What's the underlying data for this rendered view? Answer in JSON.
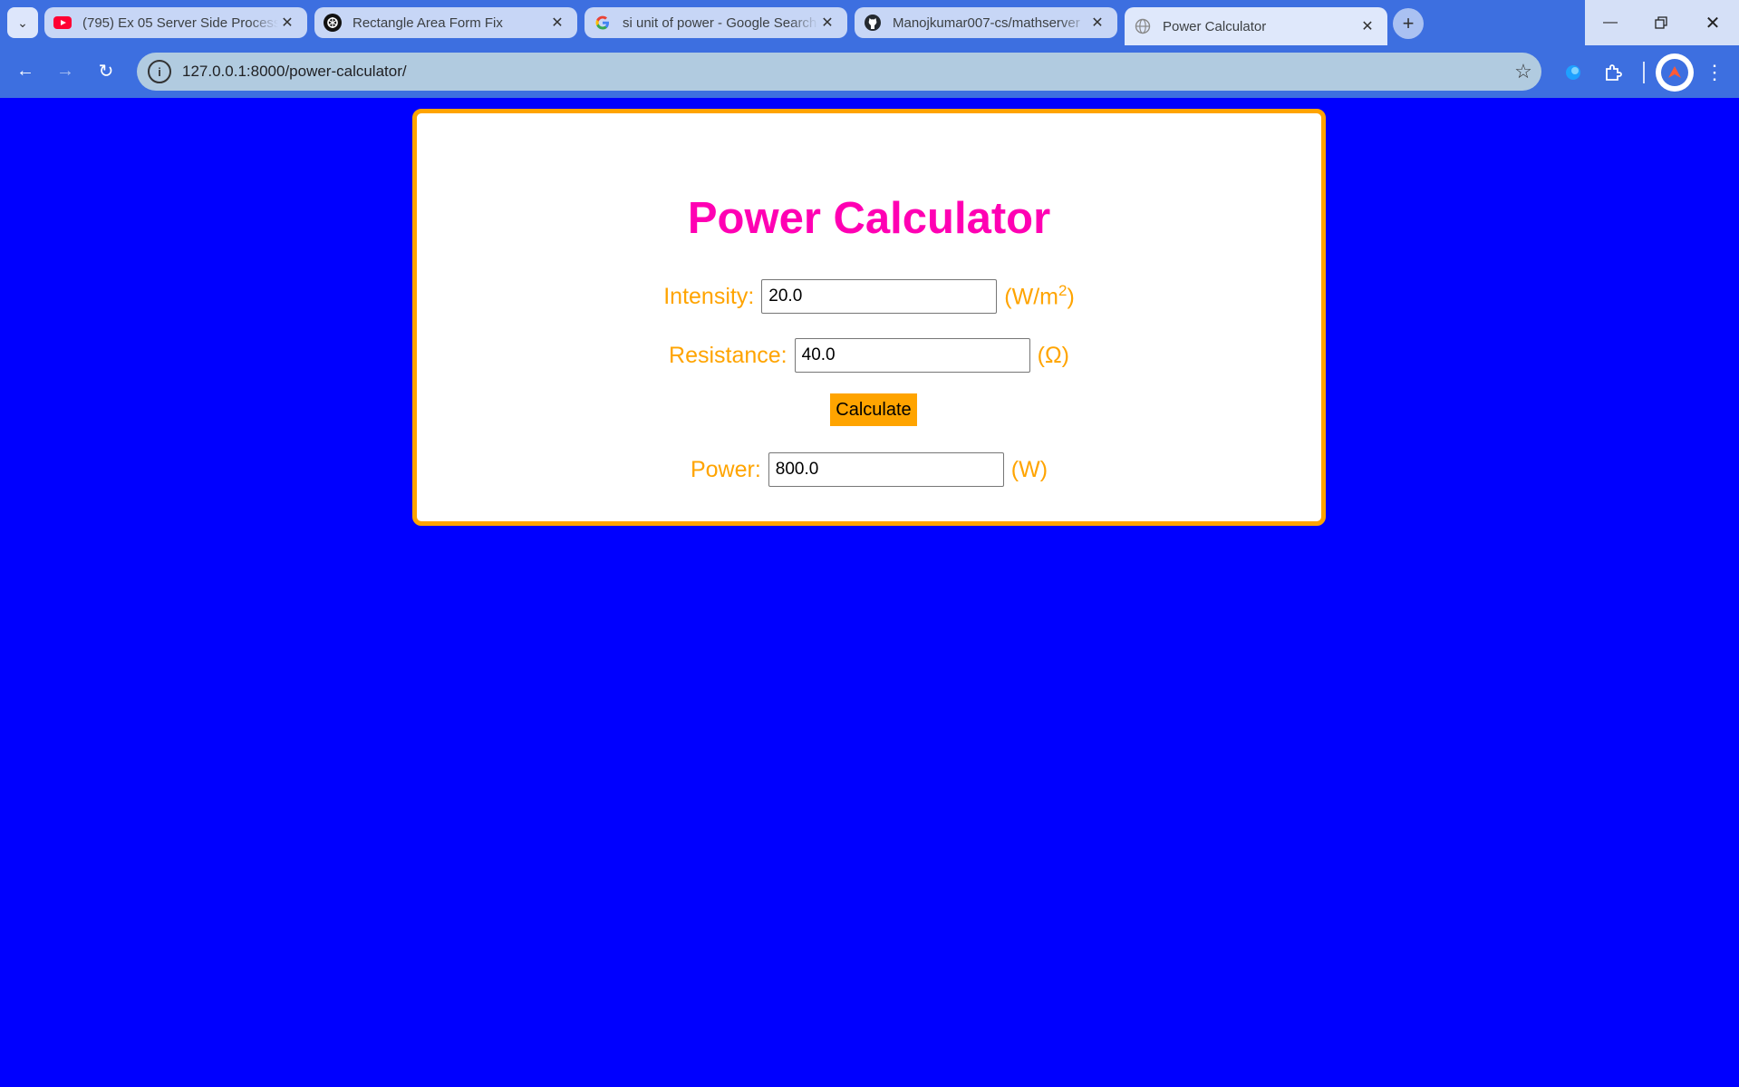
{
  "browser": {
    "tabs": [
      {
        "title": "(795) Ex 05 Server Side Processi",
        "icon": "youtube-icon",
        "active": false
      },
      {
        "title": "Rectangle Area Form Fix",
        "icon": "chatgpt-icon",
        "active": false
      },
      {
        "title": "si unit of power - Google Search",
        "icon": "google-icon",
        "active": false
      },
      {
        "title": "Manojkumar007-cs/mathserver",
        "icon": "github-icon",
        "active": false
      },
      {
        "title": "Power Calculator",
        "icon": "globe-icon",
        "active": true
      }
    ],
    "url": "127.0.0.1:8000/power-calculator/"
  },
  "page": {
    "title": "Power Calculator",
    "intensity": {
      "label": "Intensity:",
      "value": "20.0",
      "unit_prefix": "(W/m",
      "unit_sup": "2",
      "unit_suffix": ")"
    },
    "resistance": {
      "label": "Resistance:",
      "value": "40.0",
      "unit": "(Ω)"
    },
    "calculate_label": "Calculate",
    "power": {
      "label": "Power:",
      "value": "800.0",
      "unit": "(W)"
    }
  },
  "colors": {
    "page_background": "#0000ff",
    "card_border": "#ffa400",
    "title": "#ff00b3",
    "label": "#ffa400",
    "button": "#ffa400",
    "browser_chrome": "#3d6fe0"
  }
}
